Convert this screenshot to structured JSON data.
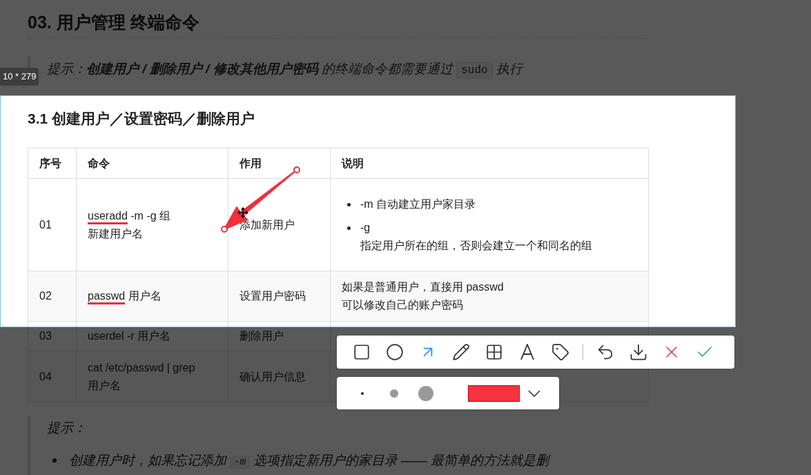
{
  "document": {
    "heading": "03. 用户管理 终端命令",
    "tip": "提示：**创建用户 / 删除用户 / 修改其他用户密码** 的终端命令都需要通过",
    "tip_code": "sudo",
    "tip_end": "执行",
    "section_title": "3.1 创建用户／设置密码／删除用户",
    "table": {
      "columns": [
        "序号",
        "命令",
        "作用",
        "说明"
      ],
      "rows": [
        {
          "number": "01",
          "command": [
            [
              {
                "text": "useradd",
                "marked": true
              },
              {
                "text": " -m -g 组",
                "marked": false
              }
            ],
            [
              {
                "text": "新建用户名",
                "marked": false
              }
            ]
          ],
          "purpose": "添加新用户",
          "notes": [
            {
              "kind": "bullet",
              "lines": [
                "-m 自动建立用户家目录"
              ]
            },
            {
              "kind": "bullet",
              "lines": [
                "-g",
                "指定用户所在的组，否则会建立一个和同名的组"
              ]
            }
          ]
        },
        {
          "number": "02",
          "command": [
            [
              {
                "text": "passwd",
                "marked": true
              },
              {
                "text": " 用户名",
                "marked": false
              }
            ]
          ],
          "purpose": "设置用户密码",
          "notes": [
            {
              "kind": "plain",
              "lines": [
                "如果是普通用户，直接用 passwd",
                "可以修改自己的账户密码"
              ]
            }
          ]
        },
        {
          "number": "03",
          "command": [
            [
              {
                "text": "userdel -r 用户名",
                "marked": false
              }
            ]
          ],
          "purpose": "删除用户"
        },
        {
          "number": "04",
          "command": [
            [
              {
                "text": "cat /etc/passwd | grep",
                "marked": false
              }
            ],
            [
              {
                "text": "用户名",
                "marked": false
              }
            ]
          ],
          "purpose": "确认用户信息"
        }
      ]
    },
    "tip2_title": "提示：",
    "tip2_bullet": "创建用户时，如果忘记添加",
    "tip2_code": "-m",
    "tip2_rest": "选项指定新用户的家目录 —— 最简单的方法就是删"
  },
  "capture": {
    "size_label": "10 * 279",
    "tools": [
      {
        "kind": "rectangle",
        "selected": false
      },
      {
        "kind": "ellipse",
        "selected": false
      },
      {
        "kind": "arrow",
        "selected": true
      },
      {
        "kind": "pen",
        "selected": false
      },
      {
        "kind": "mosaic",
        "selected": false
      },
      {
        "kind": "text",
        "selected": false
      },
      {
        "kind": "tag",
        "selected": false
      }
    ],
    "actions": [
      {
        "kind": "undo"
      },
      {
        "kind": "download"
      },
      {
        "kind": "cancel"
      },
      {
        "kind": "confirm"
      }
    ],
    "color": "#f5333f"
  }
}
